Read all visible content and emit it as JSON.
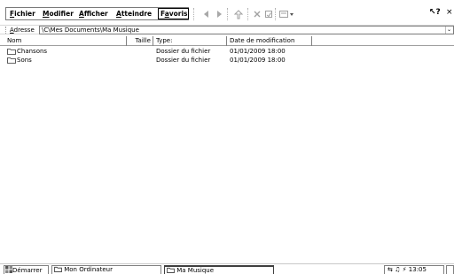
{
  "menu": {
    "items": [
      {
        "first": "F",
        "rest": "ichier"
      },
      {
        "first": "M",
        "rest": "odifier"
      },
      {
        "first": "A",
        "rest": "fficher"
      },
      {
        "first": "A",
        "rest": "tteindre"
      },
      {
        "first": "F",
        "rest": "avoris",
        "ul_index": 1
      }
    ]
  },
  "toolbar": {
    "buttons": [
      "back-icon",
      "forward-icon",
      "up-folder-icon",
      "delete-icon",
      "properties-icon",
      "views-icon"
    ],
    "help_label": "↖?",
    "close_label": "×"
  },
  "address": {
    "label_first": "A",
    "label_rest": "dresse",
    "value": "\\C\\Mes Documents\\Ma Musique",
    "dropdown": "⌄"
  },
  "list": {
    "columns": [
      "Nom",
      "Taille",
      "Type:",
      "Date de modification"
    ],
    "rows": [
      {
        "name": "Chansons",
        "size": "",
        "type": "Dossier du fichier",
        "modified": "01/01/2009 18:00"
      },
      {
        "name": "Sons",
        "size": "",
        "type": "Dossier du fichier",
        "modified": "01/01/2009 18:00"
      }
    ]
  },
  "taskbar": {
    "start_label": "Démarrer",
    "tasks": [
      "Mon Ordinateur",
      "Ma Musique"
    ],
    "time": "13:05"
  }
}
